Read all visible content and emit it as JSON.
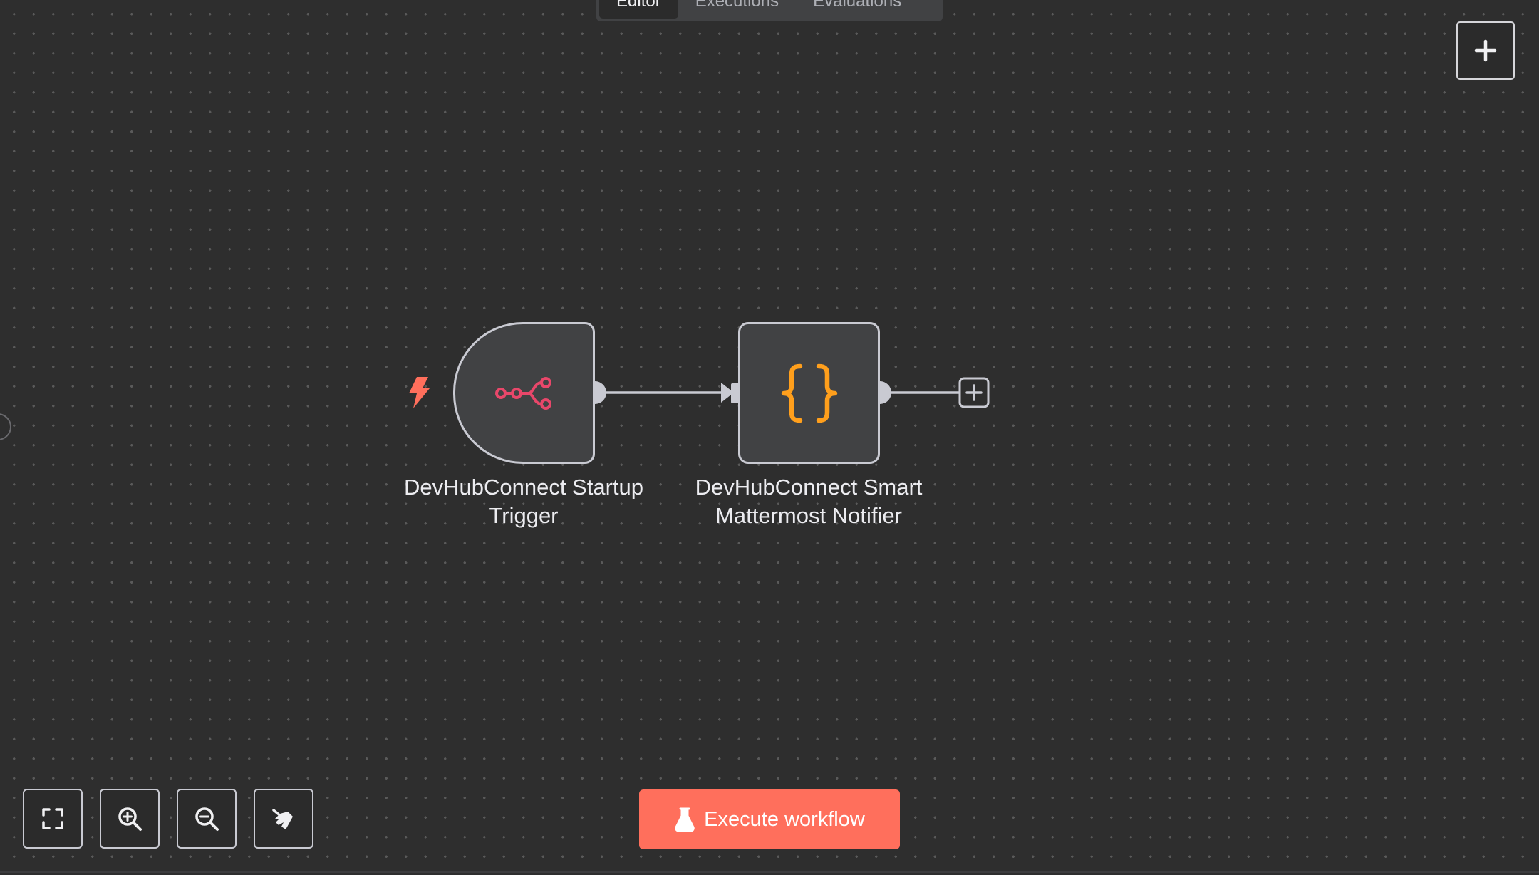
{
  "tabs": [
    {
      "label": "Editor",
      "active": true
    },
    {
      "label": "Executions",
      "active": false
    },
    {
      "label": "Evaluations",
      "active": false
    }
  ],
  "canvas": {
    "add_node_icon": "plus-icon",
    "background": "#2e2e2e"
  },
  "nodes": [
    {
      "label_line1": "DevHubConnect Startup",
      "label_line2": "Trigger",
      "icon": "sub-workflow-icon",
      "icon_color": "#e8476a",
      "badge_icon": "lightning-bolt-icon",
      "badge_color": "#ff6f5c"
    },
    {
      "label_line1": "DevHubConnect Smart",
      "label_line2": "Mattermost Notifier",
      "icon": "curly-braces-icon",
      "icon_color": "#ff9f1c"
    }
  ],
  "toolbar": {
    "fit_view_icon": "fit-view-icon",
    "zoom_in_icon": "zoom-in-icon",
    "zoom_out_icon": "zoom-out-icon",
    "tidy_up_icon": "broom-icon"
  },
  "execute_button": {
    "label": "Execute workflow",
    "icon": "flask-icon",
    "color": "#ff6f5c"
  }
}
